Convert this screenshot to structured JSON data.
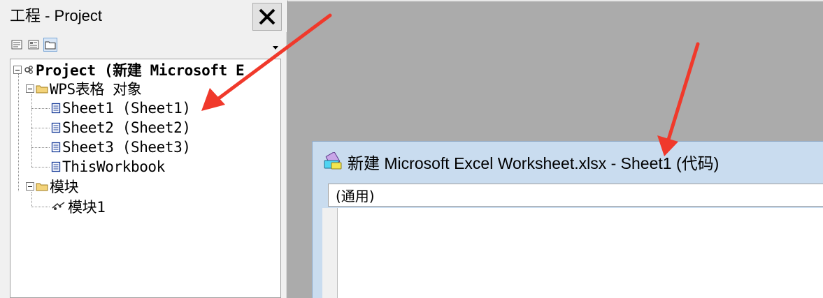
{
  "project_pane": {
    "title": "工程 - Project",
    "close_icon": "close-icon",
    "toolbar": [
      {
        "icon": "view-code-icon"
      },
      {
        "icon": "view-object-icon"
      },
      {
        "icon": "toggle-folders-icon",
        "pressed": true
      }
    ],
    "tree": {
      "root": "Project (新建 Microsoft E",
      "objects_folder": "WPS表格 对象",
      "sheets": [
        "Sheet1 (Sheet1)",
        "Sheet2 (Sheet2)",
        "Sheet3 (Sheet3)",
        "ThisWorkbook"
      ],
      "modules_folder": "模块",
      "modules": [
        "模块1"
      ]
    }
  },
  "code_window": {
    "title": "新建 Microsoft Excel Worksheet.xlsx - Sheet1 (代码)",
    "object_combo": "(通用)"
  },
  "annotation_color": "#f0392b",
  "colors": {
    "mdi_background": "#ababab",
    "code_titlebar": "#c9dcef"
  }
}
